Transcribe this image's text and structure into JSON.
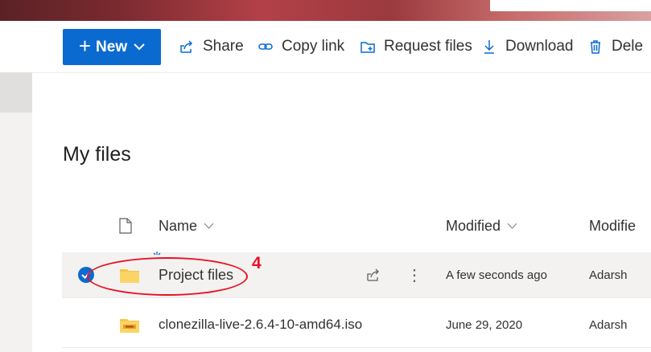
{
  "toolbar": {
    "new_label": "New",
    "share_label": "Share",
    "copy_link_label": "Copy link",
    "request_files_label": "Request files",
    "download_label": "Download",
    "delete_label": "Dele"
  },
  "page": {
    "title": "My files"
  },
  "table": {
    "columns": {
      "name": "Name",
      "modified": "Modified",
      "modified_by": "Modifie"
    },
    "rows": [
      {
        "name": "Project files",
        "modified": "A few seconds ago",
        "modified_by": "Adarsh",
        "icon": "folder-icon",
        "selected": true
      },
      {
        "name": "clonezilla-live-2.6.4-10-amd64.iso",
        "modified": "June 29, 2020",
        "modified_by": "Adarsh",
        "icon": "disc-image-icon",
        "selected": false
      }
    ]
  },
  "annotation": {
    "number": "4",
    "color": "#e81123"
  },
  "colors": {
    "accent": "#0b6ad0",
    "folder": "#f8c441",
    "selected_row": "#f3f2f1"
  }
}
